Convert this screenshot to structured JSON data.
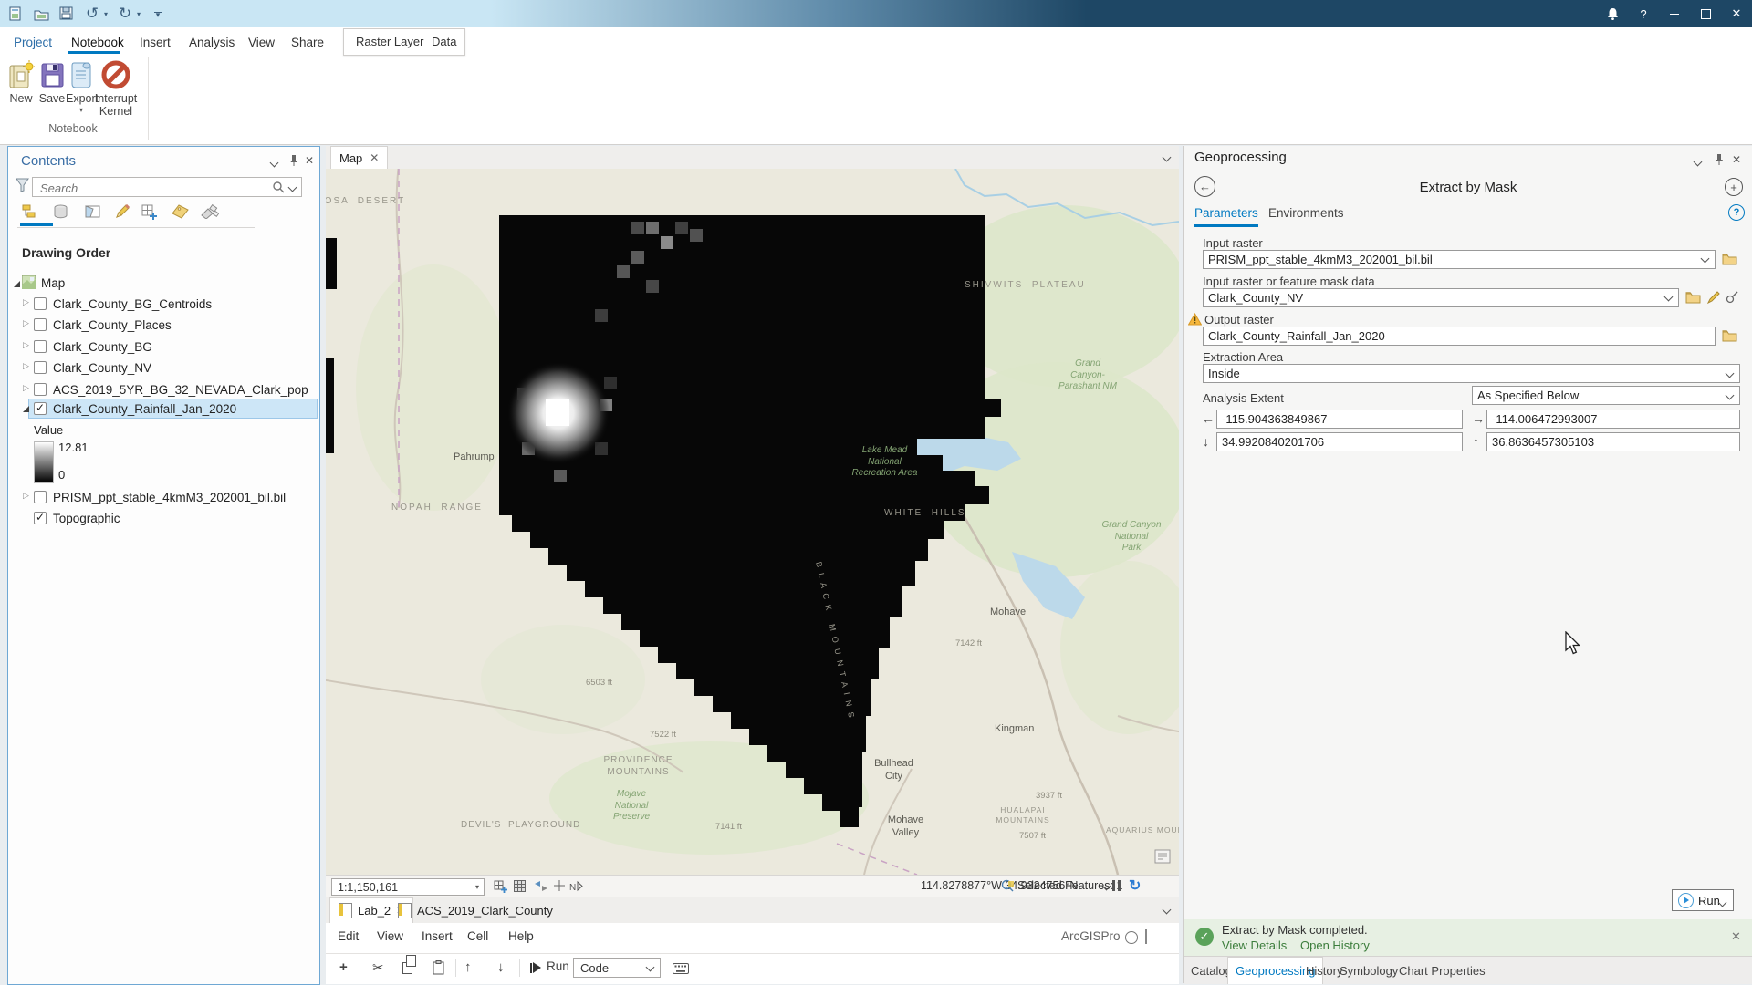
{
  "titlebar": {
    "help": "?"
  },
  "ribbon": {
    "tabs": [
      {
        "label": "Project"
      },
      {
        "label": "Notebook"
      },
      {
        "label": "Insert"
      },
      {
        "label": "Analysis"
      },
      {
        "label": "View"
      },
      {
        "label": "Share"
      }
    ],
    "contextual_tabs": [
      {
        "label": "Raster Layer"
      },
      {
        "label": "Data"
      }
    ],
    "buttons": [
      {
        "label": "New"
      },
      {
        "label": "Save"
      },
      {
        "label": "Export"
      },
      {
        "label": "Interrupt Kernel"
      }
    ],
    "group_label": "Notebook"
  },
  "contents": {
    "title": "Contents",
    "search_placeholder": "Search",
    "heading": "Drawing Order",
    "map_node": "Map",
    "layers": [
      {
        "name": "Clark_County_BG_Centroids",
        "checked": false
      },
      {
        "name": "Clark_County_Places",
        "checked": false
      },
      {
        "name": "Clark_County_BG",
        "checked": false
      },
      {
        "name": "Clark_County_NV",
        "checked": false
      },
      {
        "name": "ACS_2019_5YR_BG_32_NEVADA_Clark_pop",
        "checked": false
      },
      {
        "name": "Clark_County_Rainfall_Jan_2020",
        "checked": true,
        "selected": true
      }
    ],
    "legend": {
      "label": "Value",
      "max": "12.81",
      "min": "0"
    },
    "extra_layers": [
      {
        "name": "PRISM_ppt_stable_4kmM3_202001_bil.bil",
        "checked": false
      },
      {
        "name": "Topographic",
        "checked": true
      }
    ]
  },
  "map": {
    "tab": "Map",
    "scale": "1:1,150,161",
    "coordinates": "114.8278877°W 34.9324756°N",
    "selected_features": "Selected Features: 1",
    "labels": [
      {
        "text": "M O U N T A I N S"
      },
      {
        "text": "AMARGOSA  DESERT"
      },
      {
        "text": "SHIVWITS  PLATEAU"
      },
      {
        "text": "Grand\nCanyon-\nParashant NM"
      },
      {
        "text": "Lake Mead\nNational\nRecreation Area"
      },
      {
        "text": "WHITE  HILLS"
      },
      {
        "text": "NOPAH  RANGE"
      },
      {
        "text": "Pahrump"
      },
      {
        "text": "B L A C K   M O U N T A I N S"
      },
      {
        "text": "Mohave"
      },
      {
        "text": "7142 ft"
      },
      {
        "text": "Kingman"
      },
      {
        "text": "Bullhead\nCity"
      },
      {
        "text": "Mohave\nValley"
      },
      {
        "text": "PROVIDENCE\nMOUNTAINS"
      },
      {
        "text": "Mojave\nNational\nPreserve"
      },
      {
        "text": "DEVIL'S  PLAYGROUND"
      },
      {
        "text": "6503 ft"
      },
      {
        "text": "7522 ft"
      },
      {
        "text": "7141 ft"
      },
      {
        "text": "3937 ft"
      },
      {
        "text": "HUALAPAI\nMOUNTAINS"
      },
      {
        "text": "7507 ft"
      },
      {
        "text": "AQUARIUS MOUNTAINS"
      },
      {
        "text": "Grand Canyon\nNational\nPark"
      }
    ]
  },
  "notebook_panel": {
    "tabs": [
      {
        "label": "Lab_2"
      },
      {
        "label": "ACS_2019_Clark_County"
      }
    ],
    "menus": [
      {
        "label": "Edit"
      },
      {
        "label": "View"
      },
      {
        "label": "Insert"
      },
      {
        "label": "Cell"
      },
      {
        "label": "Help"
      }
    ],
    "run_label": "Run",
    "cell_type": "Code",
    "kernel": "ArcGISPro"
  },
  "geoprocessing": {
    "title": "Geoprocessing",
    "tool_title": "Extract by Mask",
    "tabs": [
      {
        "label": "Parameters"
      },
      {
        "label": "Environments"
      }
    ],
    "fields": {
      "input_raster_label": "Input raster",
      "input_raster_value": "PRISM_ppt_stable_4kmM3_202001_bil.bil",
      "mask_label": "Input raster or feature mask data",
      "mask_value": "Clark_County_NV",
      "output_label": "Output raster",
      "output_value": "Clark_County_Rainfall_Jan_2020",
      "extraction_area_label": "Extraction Area",
      "extraction_area_value": "Inside",
      "analysis_extent_label": "Analysis Extent",
      "analysis_extent_value": "As Specified Below",
      "extent_left": "-115.904363849867",
      "extent_right": "-114.006472993007",
      "extent_bottom": "34.9920840201706",
      "extent_top": "36.8636457305103"
    },
    "run_label": "Run",
    "message": {
      "text": "Extract by Mask completed.",
      "links": [
        {
          "label": "View Details"
        },
        {
          "label": "Open History"
        }
      ]
    },
    "bottom_tabs": [
      {
        "label": "Catalog"
      },
      {
        "label": "Geoprocessing"
      },
      {
        "label": "History"
      },
      {
        "label": "Symbology"
      },
      {
        "label": "Chart Properties"
      }
    ]
  }
}
